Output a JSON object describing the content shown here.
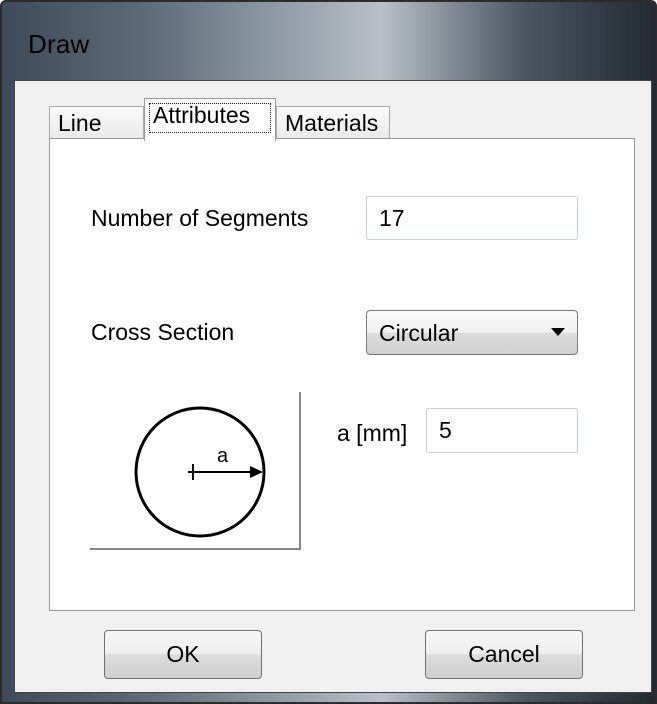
{
  "window": {
    "title": "Draw"
  },
  "tabs": [
    {
      "label": "Line"
    },
    {
      "label": "Attributes"
    },
    {
      "label": "Materials"
    }
  ],
  "fields": {
    "number_of_segments": {
      "label": "Number of Segments",
      "value": "17"
    },
    "cross_section": {
      "label": "Cross Section",
      "selected": "Circular"
    },
    "radius": {
      "label": "a  [mm]",
      "value": "5"
    }
  },
  "diagram": {
    "symbol": "a",
    "shape": "circle"
  },
  "buttons": {
    "ok": "OK",
    "cancel": "Cancel"
  },
  "icons": {
    "dropdown": "chevron-down-icon"
  }
}
